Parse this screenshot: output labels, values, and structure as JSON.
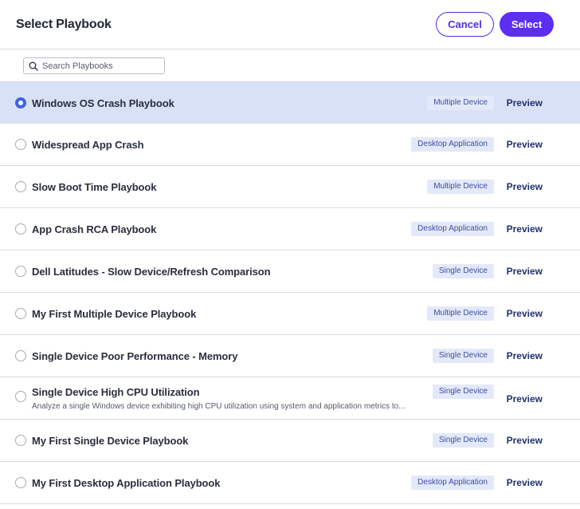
{
  "header": {
    "title": "Select Playbook",
    "cancel_label": "Cancel",
    "select_label": "Select"
  },
  "search": {
    "placeholder": "Search Playbooks",
    "value": ""
  },
  "preview_label": "Preview",
  "colors": {
    "accent": "#5b2ef0",
    "selected_row": "#d9e1f7",
    "radio_selected": "#3f63e6",
    "badge_bg": "#e3e9f8",
    "badge_text": "#3d4ea3"
  },
  "playbooks": [
    {
      "name": "Windows OS Crash Playbook",
      "type": "Multiple Device",
      "selected": true,
      "description": ""
    },
    {
      "name": "Widespread App Crash",
      "type": "Desktop Application",
      "selected": false,
      "description": ""
    },
    {
      "name": "Slow Boot Time Playbook",
      "type": "Multiple Device",
      "selected": false,
      "description": ""
    },
    {
      "name": "App Crash RCA Playbook",
      "type": "Desktop Application",
      "selected": false,
      "description": ""
    },
    {
      "name": "Dell Latitudes - Slow Device/Refresh Comparison",
      "type": "Single Device",
      "selected": false,
      "description": ""
    },
    {
      "name": "My First Multiple Device Playbook",
      "type": "Multiple Device",
      "selected": false,
      "description": ""
    },
    {
      "name": "Single Device Poor Performance - Memory",
      "type": "Single Device",
      "selected": false,
      "description": ""
    },
    {
      "name": "Single Device High CPU Utilization",
      "type": "Single Device",
      "selected": false,
      "description": "Analyze a single Windows device exhibiting high CPU utilization using system and application metrics to..."
    },
    {
      "name": "My First Single Device Playbook",
      "type": "Single Device",
      "selected": false,
      "description": ""
    },
    {
      "name": "My First Desktop Application Playbook",
      "type": "Desktop Application",
      "selected": false,
      "description": ""
    }
  ]
}
